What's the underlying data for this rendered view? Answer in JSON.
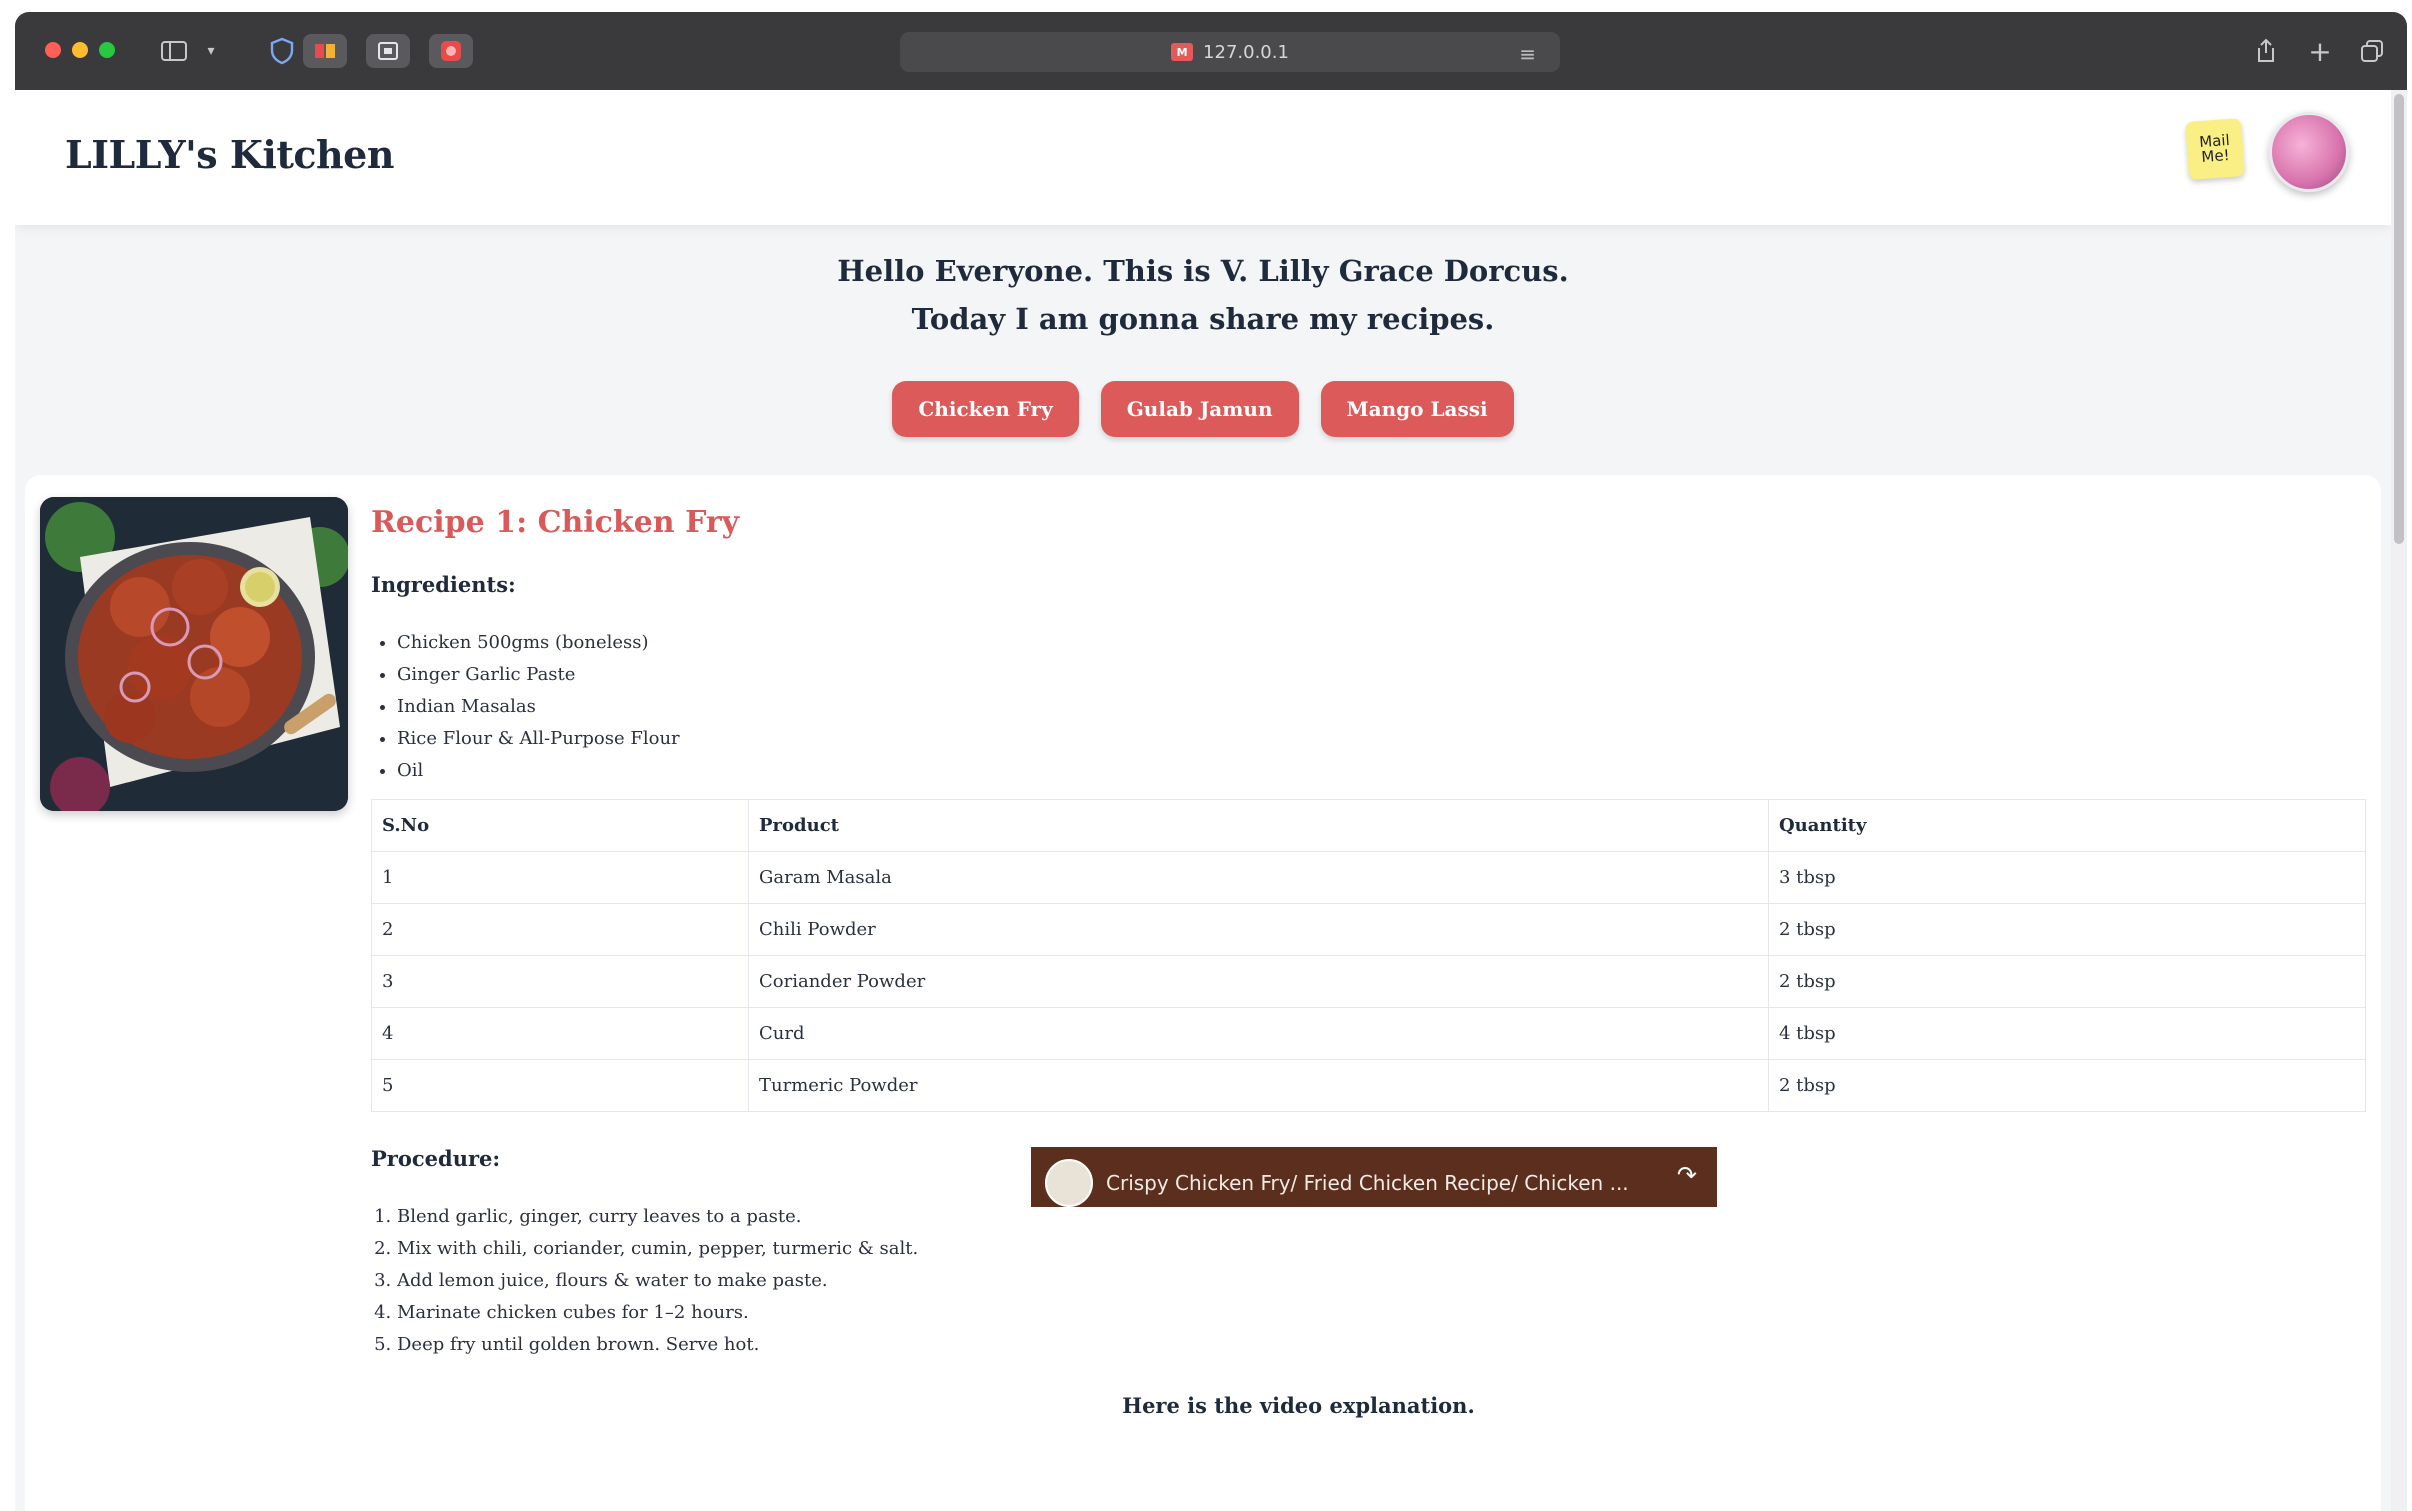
{
  "browser": {
    "url": "127.0.0.1",
    "tab_favicon_text": "M",
    "icons": [
      "sidebar-icon",
      "chevron-down-icon",
      "shield-icon",
      "extension-icon",
      "screenshot-icon",
      "record-icon",
      "reader-icon",
      "share-icon",
      "new-tab-icon",
      "tabs-overview-icon"
    ]
  },
  "header": {
    "brand": "LILLY's Kitchen",
    "note_text": "Mail Me!"
  },
  "hero": {
    "line1": "Hello Everyone. This is V. Lilly Grace Dorcus.",
    "line2": "Today I am gonna share my recipes.",
    "buttons": [
      "Chicken Fry",
      "Gulab Jamun",
      "Mango Lassi"
    ]
  },
  "recipe": {
    "title": "Recipe 1: Chicken Fry",
    "ingredients_heading": "Ingredients:",
    "ingredients": [
      "Chicken 500gms (boneless)",
      "Ginger Garlic Paste",
      "Indian Masalas",
      "Rice Flour & All-Purpose Flour",
      "Oil"
    ],
    "table": {
      "headers": [
        "S.No",
        "Product",
        "Quantity"
      ],
      "rows": [
        [
          "1",
          "Garam Masala",
          "3 tbsp"
        ],
        [
          "2",
          "Chili Powder",
          "2 tbsp"
        ],
        [
          "3",
          "Coriander Powder",
          "2 tbsp"
        ],
        [
          "4",
          "Curd",
          "4 tbsp"
        ],
        [
          "5",
          "Turmeric Powder",
          "2 tbsp"
        ]
      ]
    },
    "procedure_heading": "Procedure:",
    "procedure": [
      "Blend garlic, ginger, curry leaves to a paste.",
      "Mix with chili, coriander, cumin, pepper, turmeric & salt.",
      "Add lemon juice, flours & water to make paste.",
      "Marinate chicken cubes for 1–2 hours.",
      "Deep fry until golden brown. Serve hot."
    ],
    "video_caption": "Here is the video explanation.",
    "video_title": "Crispy Chicken Fry/ Fried Chicken Recipe/ Chicken ...",
    "video_share_label": "Share"
  },
  "colors": {
    "accent": "#dc5a5a",
    "text": "#1f2a3c",
    "page_bg": "#f4f5f7"
  }
}
